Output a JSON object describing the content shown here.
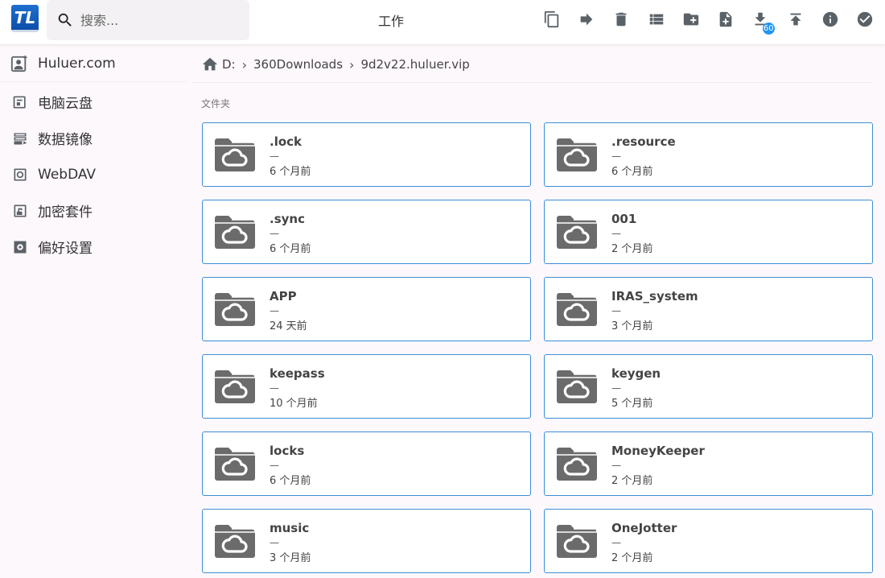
{
  "header": {
    "logo_text": "TL",
    "search_placeholder": "搜索...",
    "title": "工作",
    "download_badge": "60",
    "toolbar_icons": [
      "copy-icon",
      "move-icon",
      "delete-icon",
      "list-view-icon",
      "new-folder-icon",
      "new-file-icon",
      "download-icon",
      "upload-icon",
      "info-icon",
      "select-all-icon"
    ]
  },
  "sidebar": {
    "brand": "Huluer.com",
    "items": [
      {
        "label": "电脑云盘",
        "icon": "cloud-drive-icon"
      },
      {
        "label": "数据镜像",
        "icon": "data-mirror-icon"
      },
      {
        "label": "WebDAV",
        "icon": "webdav-icon"
      },
      {
        "label": "加密套件",
        "icon": "encryption-icon"
      },
      {
        "label": "偏好设置",
        "icon": "settings-icon"
      }
    ]
  },
  "breadcrumb": {
    "items": [
      "D:",
      "360Downloads",
      "9d2v22.huluer.vip"
    ]
  },
  "section_label": "文件夹",
  "folders": [
    {
      "name": ".lock",
      "size": "—",
      "date": "6 个月前"
    },
    {
      "name": ".resource",
      "size": "—",
      "date": "6 个月前"
    },
    {
      "name": ".sync",
      "size": "—",
      "date": "6 个月前"
    },
    {
      "name": "001",
      "size": "—",
      "date": "2 个月前"
    },
    {
      "name": "APP",
      "size": "—",
      "date": "24 天前"
    },
    {
      "name": "IRAS_system",
      "size": "—",
      "date": "3 个月前"
    },
    {
      "name": "keepass",
      "size": "—",
      "date": "10 个月前"
    },
    {
      "name": "keygen",
      "size": "—",
      "date": "5 个月前"
    },
    {
      "name": "locks",
      "size": "—",
      "date": "6 个月前"
    },
    {
      "name": "MoneyKeeper",
      "size": "—",
      "date": "2 个月前"
    },
    {
      "name": "music",
      "size": "—",
      "date": "3 个月前"
    },
    {
      "name": "OneJotter",
      "size": "—",
      "date": "2 个月前"
    }
  ]
}
